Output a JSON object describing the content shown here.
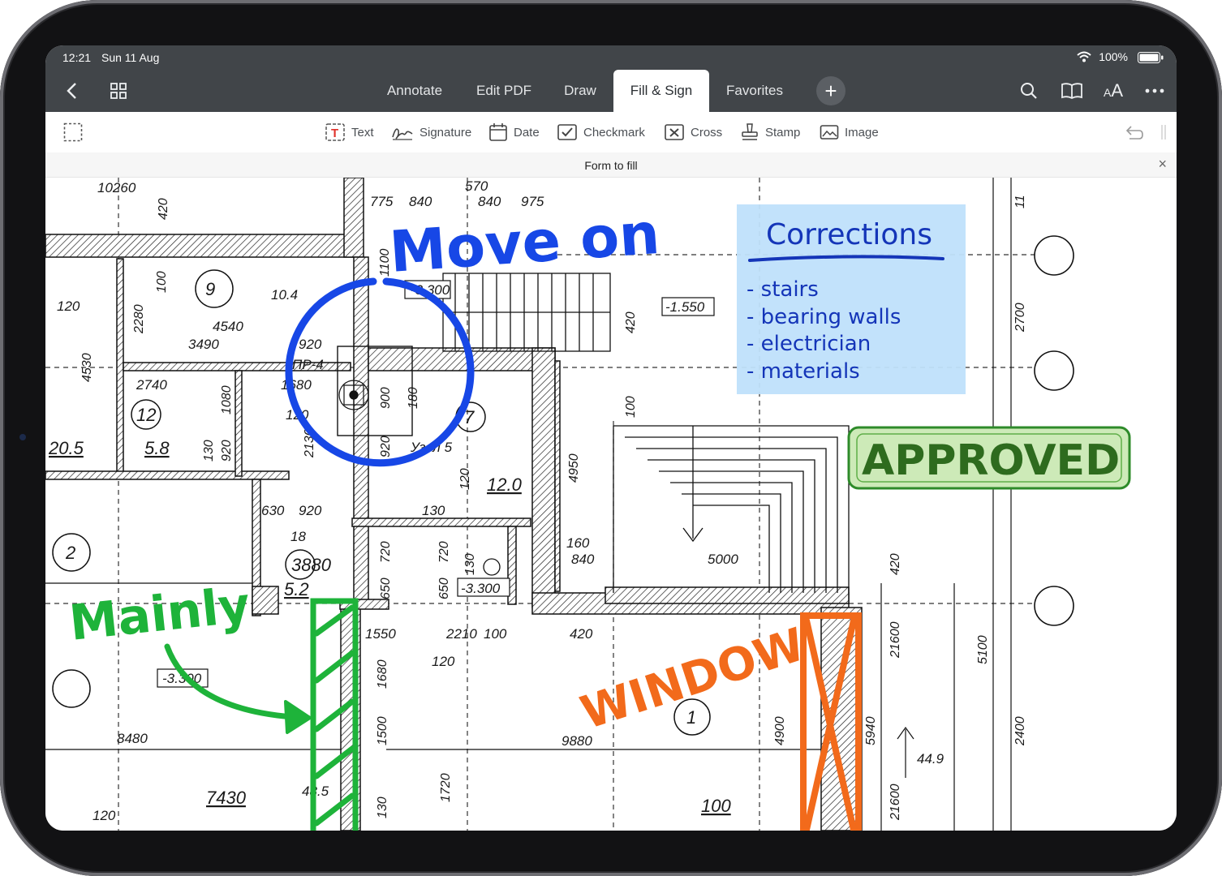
{
  "status_bar": {
    "time": "12:21",
    "date": "Sun 11 Aug",
    "battery": "100%"
  },
  "nav": {
    "tabs": [
      {
        "label": "Annotate"
      },
      {
        "label": "Edit PDF"
      },
      {
        "label": "Draw"
      },
      {
        "label": "Fill & Sign",
        "active": true
      },
      {
        "label": "Favorites"
      }
    ],
    "plus_label": "+",
    "text_size_label": "AA"
  },
  "tools": [
    {
      "label": "Text",
      "icon": "text-icon"
    },
    {
      "label": "Signature",
      "icon": "signature-icon"
    },
    {
      "label": "Date",
      "icon": "calendar-icon"
    },
    {
      "label": "Checkmark",
      "icon": "checkmark-icon"
    },
    {
      "label": "Cross",
      "icon": "cross-icon"
    },
    {
      "label": "Stamp",
      "icon": "stamp-icon"
    },
    {
      "label": "Image",
      "icon": "image-icon"
    }
  ],
  "banner": {
    "label": "Form to fill",
    "close": "×"
  },
  "annotations": {
    "move_on": "Move on",
    "mainly": "Mainly",
    "window": "WINDOW",
    "stamp": "APPROVED",
    "sticky": {
      "title": "Corrections",
      "items": [
        "- stairs",
        "- bearing walls",
        "- electrician",
        "- materials"
      ]
    }
  },
  "drawing": {
    "dims": [
      "10260",
      "420",
      "775",
      "840",
      "570",
      "840",
      "975",
      "1100",
      "100",
      "120",
      "2280",
      "4540",
      "3490",
      "10.4",
      "4530",
      "920",
      "ПР-4",
      "1680",
      "120",
      "2130",
      "2740",
      "1080",
      "12",
      "5.8",
      "20.5",
      "130",
      "920",
      "-3.300",
      "-1.550",
      "420",
      "100",
      "900",
      "180",
      "7",
      "920",
      "Узел 5",
      "120",
      "12.0",
      "4950",
      "630",
      "920",
      "3880",
      "130",
      "18",
      "5.2",
      "720",
      "720",
      "650",
      "650",
      "130",
      "-3.300",
      "160",
      "840",
      "5000",
      "420",
      "1550",
      "2210",
      "100",
      "420",
      "120",
      "1680",
      "-3.300",
      "1500",
      "8480",
      "9880",
      "4900",
      "5940",
      "3",
      "1",
      "44.9",
      "7430",
      "120",
      "1720",
      "130",
      "48.5",
      "100",
      "21600",
      "5100",
      "2400",
      "2700",
      "11",
      "9",
      "2"
    ]
  },
  "colors": {
    "chrome": "#414549",
    "blue_ink": "#1747e6",
    "green_ink": "#1eb33a",
    "orange_ink": "#f26a1b",
    "sticky_bg": "#bfe0fb",
    "stamp_green": "#2e6b1e"
  }
}
